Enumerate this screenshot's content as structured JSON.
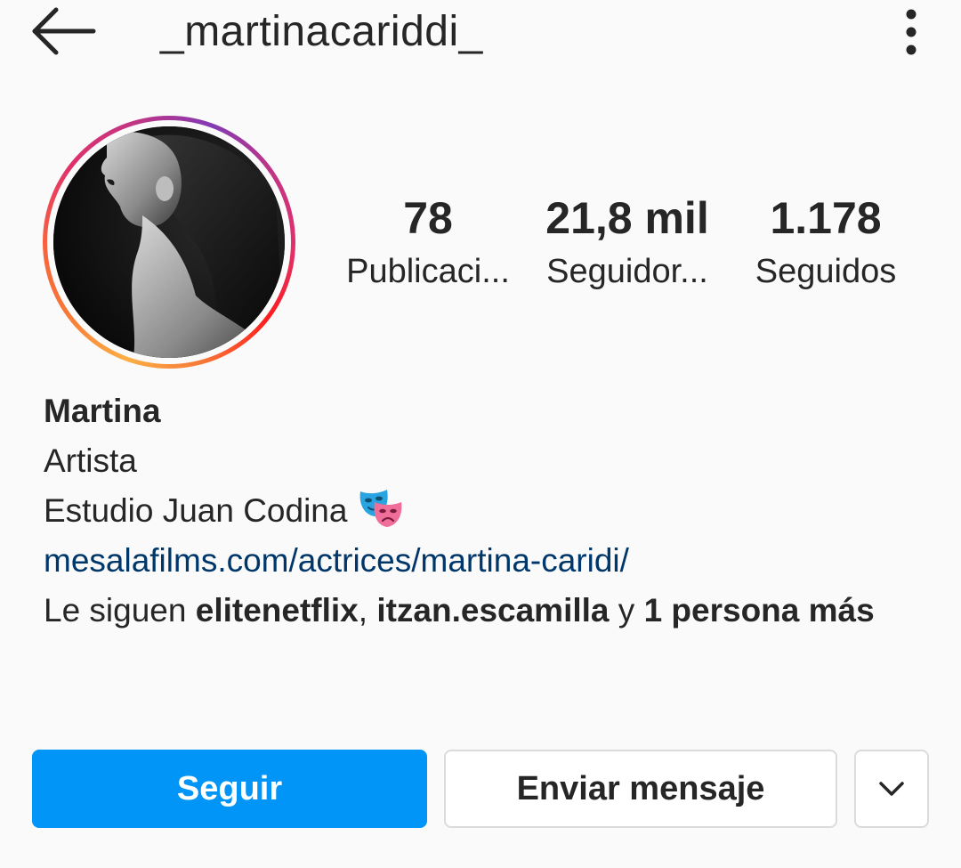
{
  "header": {
    "back_icon": "arrow-left-icon",
    "username": "_martinacariddi_",
    "more_icon": "more-vertical-icon"
  },
  "profile": {
    "avatar_ring_colors": [
      "#fcaf45",
      "#f77737",
      "#e1306c",
      "#c13584",
      "#833ab4"
    ]
  },
  "stats": [
    {
      "value": "78",
      "label": "Publicaci..."
    },
    {
      "value": "21,8 mil",
      "label": "Seguidor..."
    },
    {
      "value": "1.178",
      "label": "Seguidos"
    }
  ],
  "bio": {
    "name": "Martina",
    "category": "Artista",
    "line": "Estudio Juan Codina",
    "emoji": "performing-arts-masks-icon",
    "link": "mesalafilms.com/actrices/martina-caridi/",
    "followed_prefix": "Le siguen ",
    "followed_user_1": "elitenetflix",
    "followed_sep": ", ",
    "followed_user_2": "itzan.escamilla",
    "followed_and": " y ",
    "followed_more": "1 persona más"
  },
  "actions": {
    "follow_label": "Seguir",
    "message_label": "Enviar mensaje",
    "dropdown_icon": "chevron-down-icon"
  },
  "colors": {
    "primary": "#0095f6",
    "link": "#00376b",
    "text": "#262626",
    "border": "#dbdbdb",
    "background": "#fafafa"
  }
}
